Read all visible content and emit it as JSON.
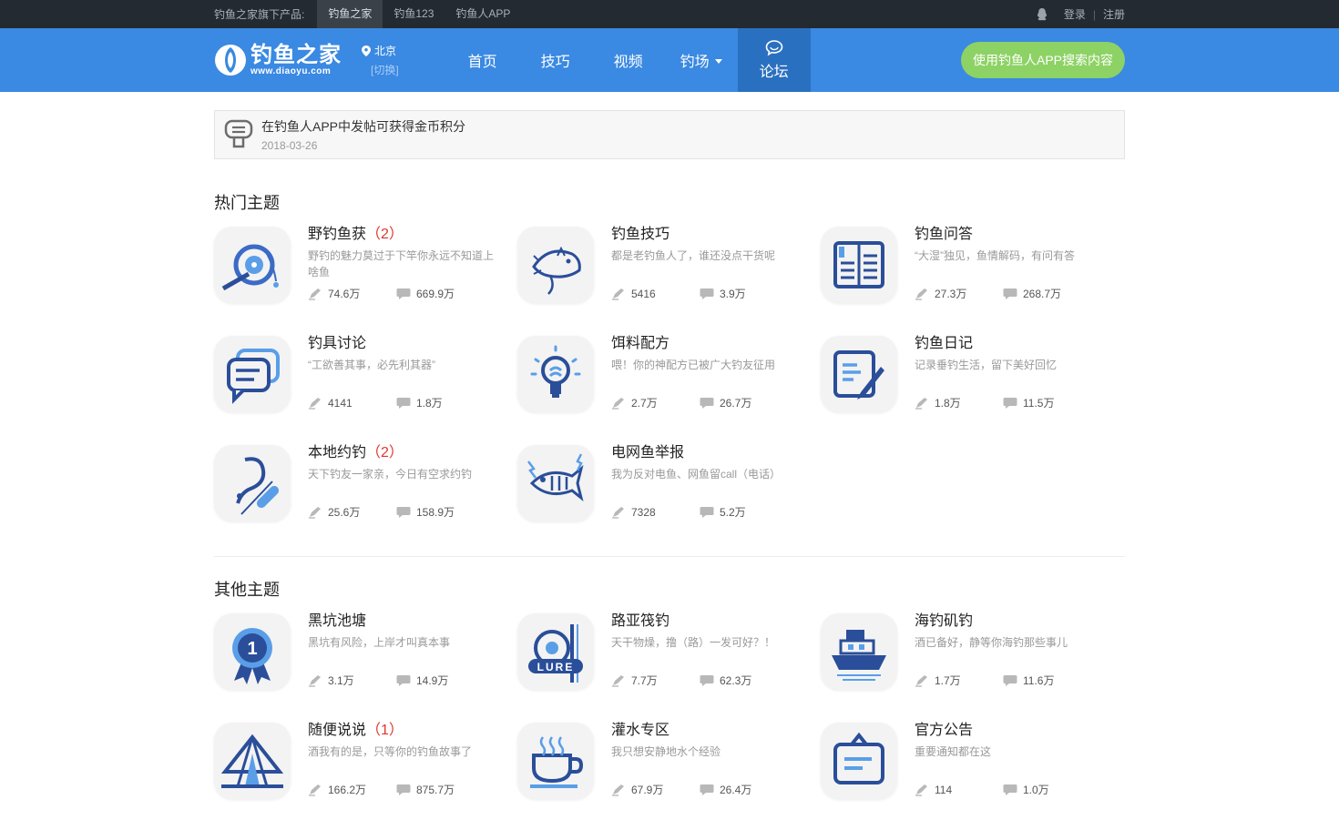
{
  "topbar": {
    "products_label": "钓鱼之家旗下产品:",
    "products": [
      "钓鱼之家",
      "钓鱼123",
      "钓鱼人APP"
    ],
    "login": "登录",
    "register": "注册",
    "separator": "|"
  },
  "header": {
    "logo_cn": "钓鱼之家",
    "logo_en": "www.diaoyu.com",
    "city": "北京",
    "city_switch": "[切换]",
    "nav": [
      "首页",
      "技巧",
      "视频",
      "钓场"
    ],
    "nav_active": "论坛",
    "app_button": "使用钓鱼人APP搜索内容",
    "brand_color": "#3a89e2"
  },
  "notice": {
    "title": "在钓鱼人APP中发帖可获得金币积分",
    "date": "2018-03-26"
  },
  "hot": {
    "title": "热门主题",
    "items": [
      {
        "name": "野钓鱼获",
        "count": "（2）",
        "desc": "野钓的魅力莫过于下竿你永远不知道上啥鱼",
        "posts": "74.6万",
        "replies": "669.9万",
        "icon": "fishing-reel-icon"
      },
      {
        "name": "钓鱼技巧",
        "count": "",
        "desc": "都是老钓鱼人了，谁还没点干货呢",
        "posts": "5416",
        "replies": "3.9万",
        "icon": "bass-fish-icon"
      },
      {
        "name": "钓鱼问答",
        "count": "",
        "desc": "“大湿”独见，鱼情解码，有问有答",
        "posts": "27.3万",
        "replies": "268.7万",
        "icon": "open-book-icon"
      },
      {
        "name": "钓具讨论",
        "count": "",
        "desc": "“工欲善其事，必先利其器”",
        "posts": "4141",
        "replies": "1.8万",
        "icon": "chat-bubbles-icon"
      },
      {
        "name": "饵料配方",
        "count": "",
        "desc": "喂！你的神配方已被广大钓友征用",
        "posts": "2.7万",
        "replies": "26.7万",
        "icon": "lightbulb-icon"
      },
      {
        "name": "钓鱼日记",
        "count": "",
        "desc": "记录垂钓生活，留下美好回忆",
        "posts": "1.8万",
        "replies": "11.5万",
        "icon": "diary-pen-icon"
      },
      {
        "name": "本地约钓",
        "count": "（2）",
        "desc": "天下钓友一家亲，今日有空求约钓",
        "posts": "25.6万",
        "replies": "158.9万",
        "icon": "hook-float-icon"
      },
      {
        "name": "电网鱼举报",
        "count": "",
        "desc": "我为反对电鱼、网鱼留call（电话）",
        "posts": "7328",
        "replies": "5.2万",
        "icon": "electrocuted-fish-icon"
      }
    ]
  },
  "other": {
    "title": "其他主题",
    "items": [
      {
        "name": "黑坑池塘",
        "count": "",
        "desc": "黑坑有风险，上岸才叫真本事",
        "posts": "3.1万",
        "replies": "14.9万",
        "icon": "medal-icon"
      },
      {
        "name": "路亚筏钓",
        "count": "",
        "desc": "天干物燥，撸（路）一发可好？！",
        "posts": "7.7万",
        "replies": "62.3万",
        "icon": "lure-reel-icon"
      },
      {
        "name": "海钓矶钓",
        "count": "",
        "desc": "酒已备好，静等你海钓那些事儿",
        "posts": "1.7万",
        "replies": "11.6万",
        "icon": "ship-icon"
      },
      {
        "name": "随便说说",
        "count": "（1）",
        "desc": "酒我有的是，只等你的钓鱼故事了",
        "posts": "166.2万",
        "replies": "875.7万",
        "icon": "tent-icon"
      },
      {
        "name": "灌水专区",
        "count": "",
        "desc": "我只想安静地水个经验",
        "posts": "67.9万",
        "replies": "26.4万",
        "icon": "coffee-cup-icon"
      },
      {
        "name": "官方公告",
        "count": "",
        "desc": "重要通知都在这",
        "posts": "114",
        "replies": "1.0万",
        "icon": "notice-board-icon"
      }
    ]
  }
}
